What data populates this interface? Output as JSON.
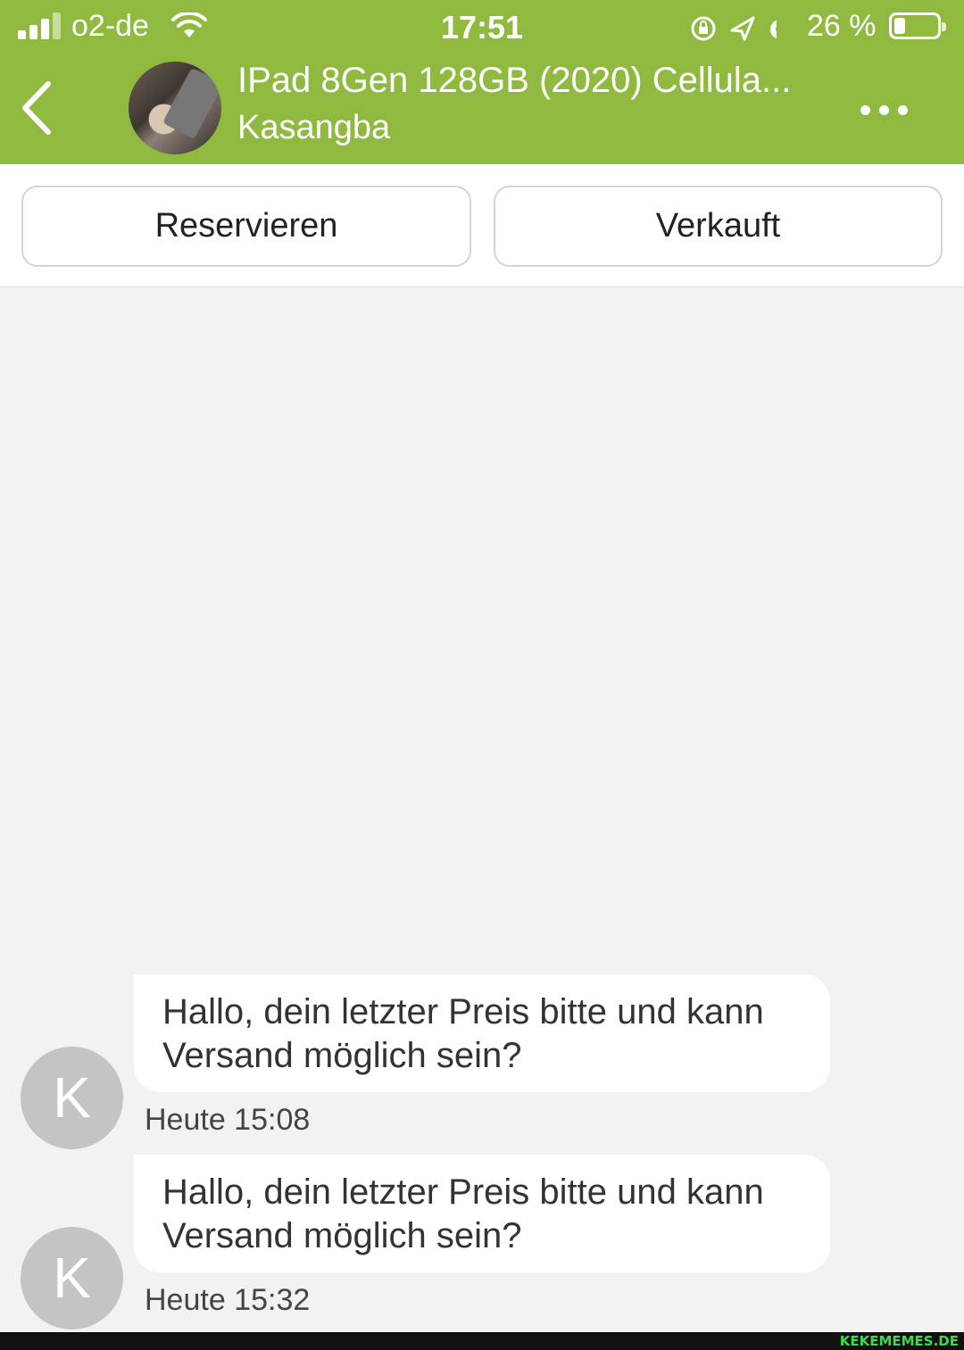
{
  "status_bar": {
    "carrier": "o2-de",
    "time": "17:51",
    "battery_percent": "26 %",
    "icons": [
      "signal-icon",
      "wifi-icon",
      "orientation-lock-icon",
      "location-arrow-icon",
      "alarm-icon",
      "battery-icon"
    ]
  },
  "header": {
    "title": "IPad 8Gen 128GB (2020) Cellula...",
    "subtitle": "Kasangba",
    "back_icon": "chevron-left-icon",
    "more_icon": "more-dots-icon"
  },
  "actions": {
    "reserve_label": "Reservieren",
    "sold_label": "Verkauft"
  },
  "messages": [
    {
      "avatar_letter": "K",
      "text_line1": "Hallo, dein letzter Preis bitte und kann",
      "text_line2": "Versand möglich sein?",
      "time": "Heute 15:08"
    },
    {
      "avatar_letter": "K",
      "text_line1": "Hallo, dein letzter Preis bitte und kann",
      "text_line2": "Versand möglich sein?",
      "time": "Heute 15:32"
    }
  ],
  "watermark": "KEKEMEMES.DE",
  "colors": {
    "brand_green": "#8fba3f",
    "background": "#f2f2f2",
    "avatar_gray": "#c4c4c4"
  }
}
